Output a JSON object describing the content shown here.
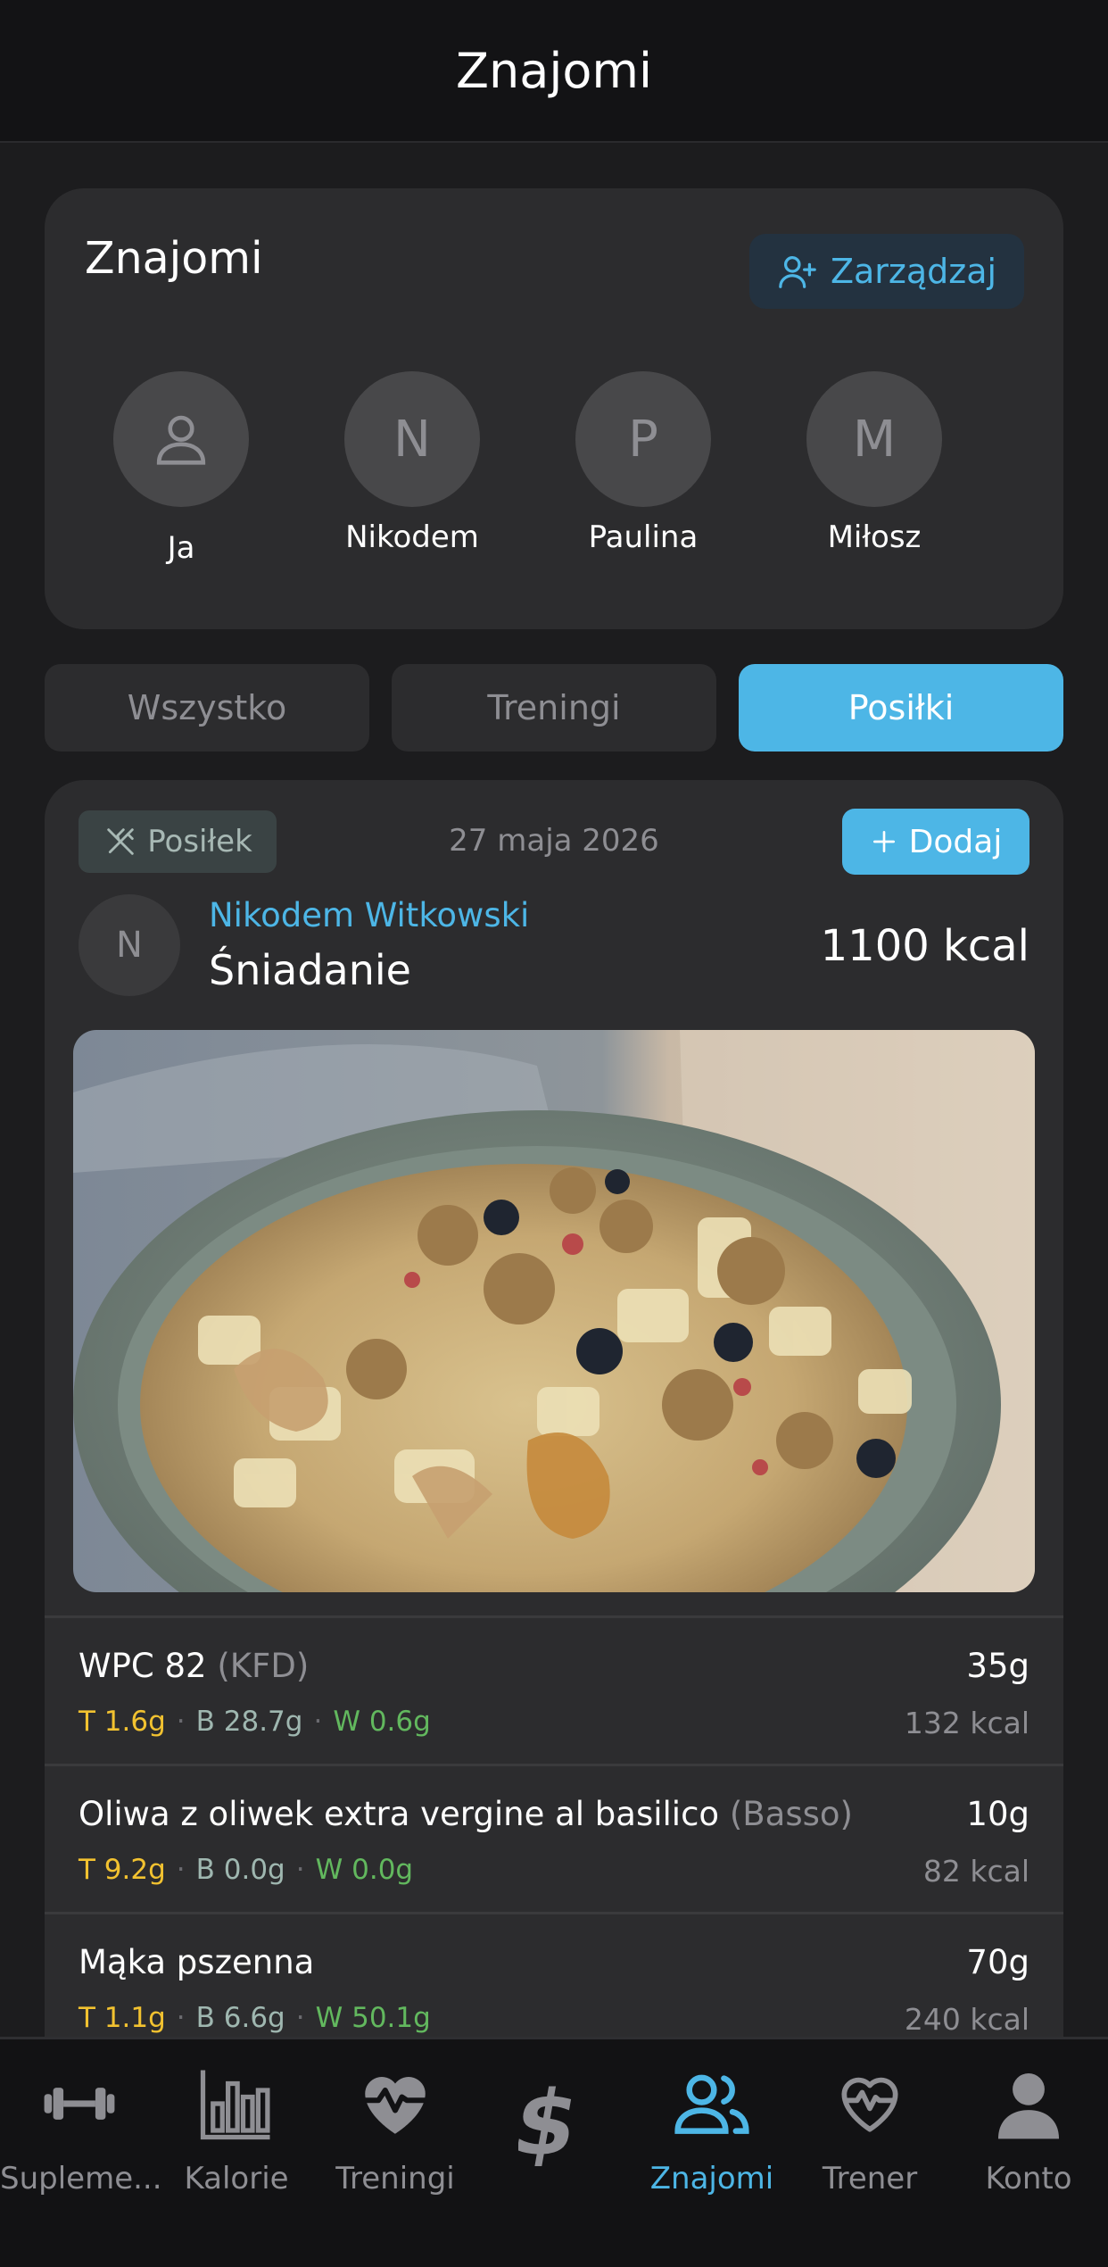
{
  "header": {
    "title": "Znajomi"
  },
  "friends_card": {
    "title": "Znajomi",
    "manage_label": "Zarządzaj",
    "friends": [
      {
        "initial": "",
        "name": "Ja",
        "icon": "person-icon"
      },
      {
        "initial": "N",
        "name": "Nikodem"
      },
      {
        "initial": "P",
        "name": "Paulina"
      },
      {
        "initial": "M",
        "name": "Miłosz"
      }
    ]
  },
  "filters": [
    {
      "label": "Wszystko",
      "active": false
    },
    {
      "label": "Treningi",
      "active": false
    },
    {
      "label": "Posiłki",
      "active": true
    }
  ],
  "post": {
    "badge": "Posiłek",
    "badge_icon": "fork-knife-icon",
    "date": "27 maja 2026",
    "add_label": "Dodaj",
    "avatar_initial": "N",
    "author": "Nikodem Witkowski",
    "meal": "Śniadanie",
    "kcal": "1100 kcal",
    "items": [
      {
        "name": "WPC 82",
        "brand": "(KFD)",
        "t": "T 1.6g",
        "b": "B 28.7g",
        "w": "W 0.6g",
        "grams": "35g",
        "kcal": "132 kcal"
      },
      {
        "name": "Oliwa z oliwek extra vergine al basilico",
        "brand": "(Basso)",
        "t": "T 9.2g",
        "b": "B 0.0g",
        "w": "W 0.0g",
        "grams": "10g",
        "kcal": "82 kcal"
      },
      {
        "name": "Mąka pszenna",
        "brand": "",
        "t": "T 1.1g",
        "b": "B 6.6g",
        "w": "W 50.1g",
        "grams": "70g",
        "kcal": "240 kcal"
      }
    ]
  },
  "tabbar": [
    {
      "label": "Supleme...",
      "icon": "dumbbell-icon",
      "active": false
    },
    {
      "label": "Kalorie",
      "icon": "bar-chart-icon",
      "active": false
    },
    {
      "label": "Treningi",
      "icon": "heart-pulse-icon",
      "active": false
    },
    {
      "label": "",
      "icon": "dollar-icon",
      "active": false
    },
    {
      "label": "Znajomi",
      "icon": "friends-icon",
      "active": true
    },
    {
      "label": "Trener",
      "icon": "heart-outline-icon",
      "active": false
    },
    {
      "label": "Konto",
      "icon": "account-icon",
      "active": false
    }
  ],
  "colors": {
    "accent": "#4db6e6",
    "background": "#1c1c1e",
    "card": "#2c2c2e",
    "fat": "#f2c230",
    "protein": "#9fb7b0",
    "carbs": "#62b85e"
  }
}
